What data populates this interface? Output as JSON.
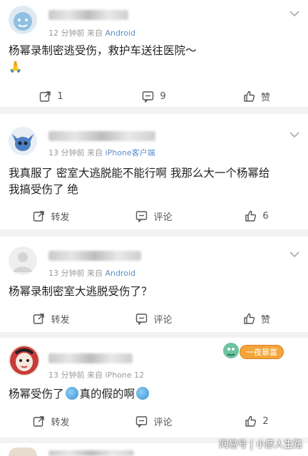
{
  "comments": [
    {
      "time": "12 分钟前",
      "source_prefix": "来自",
      "source_name": "Android",
      "text_lines": [
        "杨幂录制密逃受伤，救护车送往医院～",
        "🙏"
      ],
      "actions": {
        "repost": "1",
        "comment": "9",
        "like": "赞"
      }
    },
    {
      "time": "13 分钟前",
      "source_prefix": "来自",
      "source_name": "iPhone客户端",
      "text_lines": [
        "我真服了 密室大逃脱能不能行啊 我那么大一个杨幂给",
        "我搞受伤了 绝"
      ],
      "actions": {
        "repost": "转发",
        "comment": "评论",
        "like": "6"
      }
    },
    {
      "time": "13 分钟前",
      "source_prefix": "来自",
      "source_name": "Android",
      "text_lines": [
        "杨幂录制密室大逃脱受伤了？"
      ],
      "actions": {
        "repost": "转发",
        "comment": "评论",
        "like": "赞"
      }
    },
    {
      "time": "13 分钟前",
      "source_prefix": "来自",
      "source_name": "iPhone 12",
      "text_lines": [
        "杨幂受伤了",
        "真的假的啊"
      ],
      "actions": {
        "repost": "转发",
        "comment": "评论",
        "like": "2"
      }
    }
  ],
  "badge_text": "一夜暴富",
  "watermark": "网易号 | 小彦人生路",
  "colors": {
    "source_blue": "#5b8ec7",
    "meta_gray": "#9a9a9a",
    "divider": "#f2f2f2"
  }
}
